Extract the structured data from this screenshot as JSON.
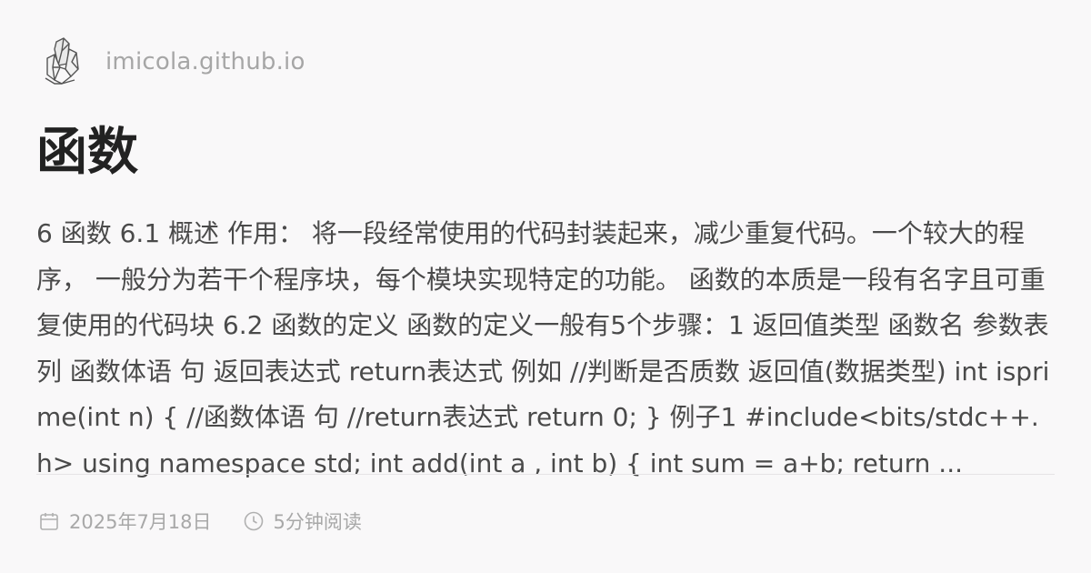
{
  "site": {
    "name": "imicola.github.io",
    "logo_icon": "crystal-cluster-icon"
  },
  "post": {
    "title": "函数",
    "excerpt": "6 函数 6.1 概述 作用： 将一段经常使用的代码封装起来，减少重复代码。一个较大的程序， 一般分为若干个程序块，每个模块实现特定的功能。 函数的本质是一段有名字且可重复使用的代码块 6.2 函数的定义 函数的定义一般有5个步骤：1 返回值类型 函数名 参数表列 函数体语 句 返回表达式 return表达式 例如 //判断是否质数 返回值(数据类型) int isprime(int n) { //函数体语 句 //return表达式 return 0; } 例子1 #include<bits/stdc++.h> using namespace std; int add(int a , int b) { int sum = a+b; return ..."
  },
  "meta": {
    "date": "2025年7月18日",
    "date_icon": "calendar-icon",
    "read_time": "5分钟阅读",
    "read_time_icon": "clock-icon"
  }
}
